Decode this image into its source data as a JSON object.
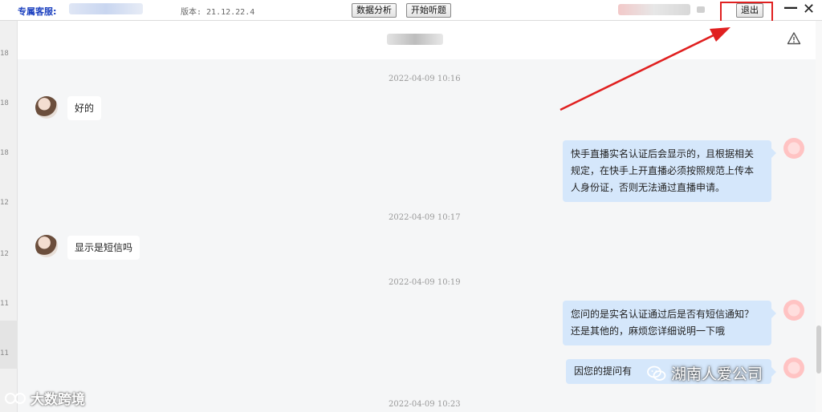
{
  "topbar": {
    "service_label": "专属客服:",
    "version": "版本: 21.12.22.4",
    "data_analysis_button": "数据分析",
    "start_listen_button": "开始听题",
    "exit_button": "退出",
    "minimize_glyph": "—",
    "close_glyph": "✕"
  },
  "left_strip": {
    "numbers": [
      "18",
      "18",
      "18",
      "12",
      "12",
      "11",
      "11"
    ]
  },
  "header": {
    "warning_icon": "warning-triangle-icon"
  },
  "messages": [
    {
      "type": "timestamp",
      "text": "2022-04-09 10:16"
    },
    {
      "type": "incoming",
      "text": "好的"
    },
    {
      "type": "outgoing",
      "lines": [
        "快手直播实名认证后会显示的，且根据相关",
        "规定，在快手上开直播必须按照规范上传本",
        "人身份证，否则无法通过直播申请。"
      ]
    },
    {
      "type": "timestamp",
      "text": "2022-04-09 10:17"
    },
    {
      "type": "incoming",
      "text": "显示是短信吗"
    },
    {
      "type": "timestamp",
      "text": "2022-04-09 10:19"
    },
    {
      "type": "outgoing",
      "lines": [
        "您问的是实名认证通过后是否有短信通知？",
        "还是其他的，麻烦您详细说明一下哦"
      ]
    },
    {
      "type": "outgoing",
      "lines": [
        "因您的提问有"
      ]
    },
    {
      "type": "timestamp",
      "text": "2022-04-09 10:23"
    }
  ],
  "watermarks": {
    "left": "大数跨境",
    "right": "湖南人爱公司"
  },
  "colors": {
    "accent_red": "#e02020",
    "bubble_out": "#d5e7fb",
    "service_label": "#1a3fbf"
  }
}
